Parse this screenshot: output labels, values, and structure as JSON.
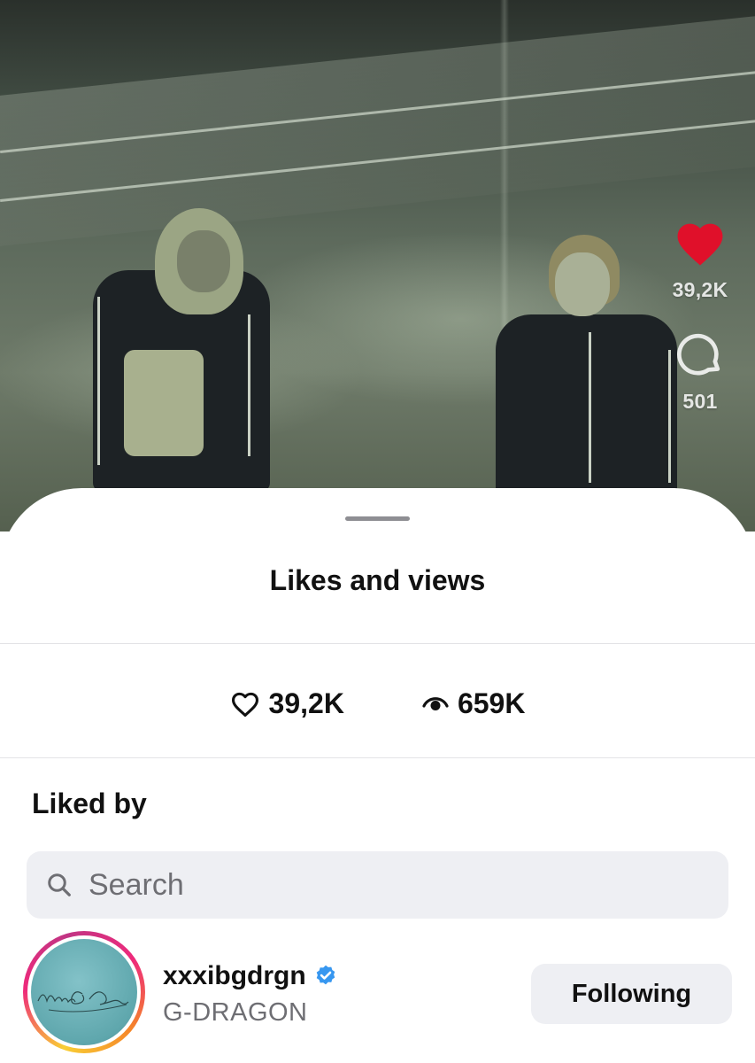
{
  "video": {
    "likes_count": "39,2K",
    "comments_count": "501",
    "like_color": "#e0102a"
  },
  "sheet": {
    "title": "Likes and views",
    "stats": {
      "likes": "39,2K",
      "views": "659K"
    },
    "liked_by_heading": "Liked by",
    "search": {
      "placeholder": "Search"
    },
    "users": [
      {
        "username": "xxxibgdrgn",
        "full_name": "G-DRAGON",
        "verified": true,
        "follow_label": "Following",
        "avatar_signature": "Monsieur G-Dragon"
      }
    ]
  },
  "colors": {
    "verified_badge": "#3797f0",
    "story_ring": [
      "#f9ce34",
      "#ee2a7b",
      "#c13584"
    ]
  }
}
